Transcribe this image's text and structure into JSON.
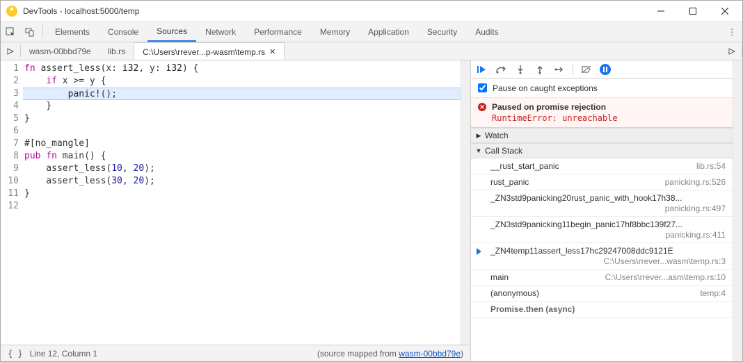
{
  "window": {
    "title": "DevTools - localhost:5000/temp"
  },
  "panels": {
    "items": [
      "Elements",
      "Console",
      "Sources",
      "Network",
      "Performance",
      "Memory",
      "Application",
      "Security",
      "Audits"
    ],
    "active_index": 2
  },
  "file_tabs": {
    "items": [
      "wasm-00bbd79e",
      "lib.rs",
      "C:\\Users\\rrever...p-wasm\\temp.rs"
    ],
    "active_index": 2
  },
  "source": {
    "lines": [
      "fn assert_less(x: i32, y: i32) {",
      "    if x >= y {",
      "        panic!();",
      "    }",
      "}",
      "",
      "#[no_mangle]",
      "pub fn main() {",
      "    assert_less(10, 20);",
      "    assert_less(30, 20);",
      "}",
      ""
    ],
    "highlight_line": 3,
    "line_count": 12
  },
  "status": {
    "cursor": "Line 12, Column 1",
    "mapped_prefix": "(source mapped from ",
    "mapped_link": "wasm-00bbd79e",
    "mapped_suffix": ")"
  },
  "debugger": {
    "pause_on_caught": "Pause on caught exceptions",
    "pause_checked": true,
    "banner_title": "Paused on promise rejection",
    "banner_msg": "RuntimeError: unreachable",
    "sections": {
      "watch": "Watch",
      "callstack": "Call Stack"
    },
    "frames": [
      {
        "name": "__rust_start_panic",
        "loc": "lib.rs:54",
        "sub": false,
        "current": false
      },
      {
        "name": "rust_panic",
        "loc": "panicking.rs:526",
        "sub": false,
        "current": false
      },
      {
        "name": "_ZN3std9panicking20rust_panic_with_hook17h38...",
        "loc": "panicking.rs:497",
        "sub": true,
        "current": false
      },
      {
        "name": "_ZN3std9panicking11begin_panic17hf8bbc139f27...",
        "loc": "panicking.rs:411",
        "sub": true,
        "current": false
      },
      {
        "name": "_ZN4temp11assert_less17hc29247008ddc9121E",
        "loc": "C:\\Users\\rrever...wasm\\temp.rs:3",
        "sub": true,
        "current": true
      },
      {
        "name": "main",
        "loc": "C:\\Users\\rrever...asm\\temp.rs:10",
        "sub": false,
        "current": false
      },
      {
        "name": "(anonymous)",
        "loc": "temp:4",
        "sub": false,
        "current": false
      }
    ],
    "async_label": "Promise.then (async)"
  }
}
